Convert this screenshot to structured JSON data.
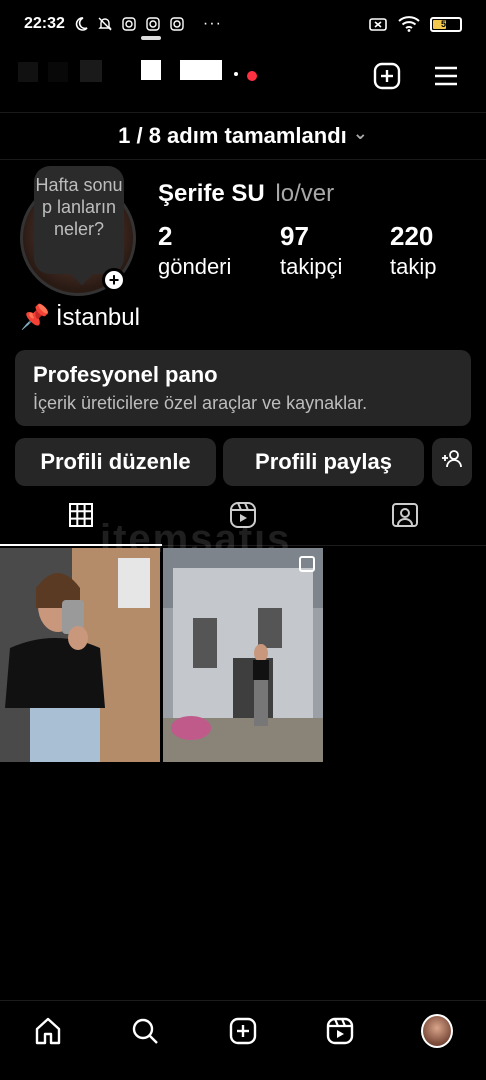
{
  "status_bar": {
    "time": "22:32",
    "battery_level": "50",
    "battery_color": "#f2c94c",
    "icons_left": [
      "moon-icon",
      "bell-off-icon",
      "instagram-icon",
      "instagram-icon",
      "instagram-icon",
      "more-icon"
    ],
    "icons_right": [
      "sim-off-icon",
      "wifi-icon",
      "battery-icon"
    ],
    "more_label": "···"
  },
  "header": {
    "notification_color": "#ff3040",
    "icons": [
      "add-post-icon",
      "menu-icon"
    ]
  },
  "progress": {
    "text": "1 / 8 adım tamamlandı",
    "chevron": "⌄"
  },
  "profile": {
    "note": "Hafta sonu p lanların neler?",
    "name": "Şerife SU",
    "pronouns": "lo/ver",
    "location_icon": "📌",
    "location": "İstanbul",
    "stats": [
      {
        "value": "2",
        "label": "gönderi"
      },
      {
        "value": "97",
        "label": "takipçi"
      },
      {
        "value": "220",
        "label": "takip"
      }
    ]
  },
  "pro_dashboard": {
    "title": "Profesyonel pano",
    "subtitle": "İçerik üreticilere özel araçlar ve kaynaklar."
  },
  "buttons": {
    "edit": "Profili düzenle",
    "share": "Profili paylaş"
  },
  "tabs": [
    "grid-icon",
    "reels-icon",
    "tagged-icon"
  ],
  "watermark": "itemsatış",
  "posts": [
    {
      "alt": "selfie-post"
    },
    {
      "alt": "house-post"
    }
  ],
  "bottom_nav": [
    "home-icon",
    "search-icon",
    "create-icon",
    "reels-icon",
    "profile-avatar"
  ]
}
